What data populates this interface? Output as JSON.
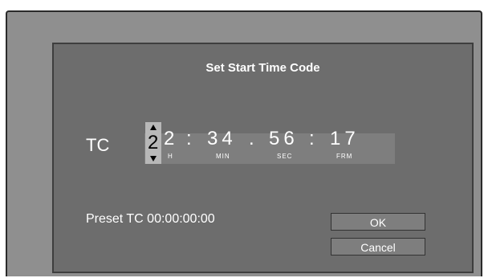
{
  "dialog": {
    "title": "Set Start Time Code",
    "tc_label": "TC",
    "timecode": {
      "hours_active_digit": "2",
      "hours_rest": "2",
      "sep1": ":",
      "minutes": "34",
      "sep2": ".",
      "seconds": "56",
      "sep3": ":",
      "frames": "17",
      "unit_h": "H",
      "unit_min": "MIN",
      "unit_sec": "SEC",
      "unit_frm": "FRM"
    },
    "preset_text": "Preset TC 00:00:00:00",
    "ok_label": "OK",
    "cancel_label": "Cancel"
  }
}
